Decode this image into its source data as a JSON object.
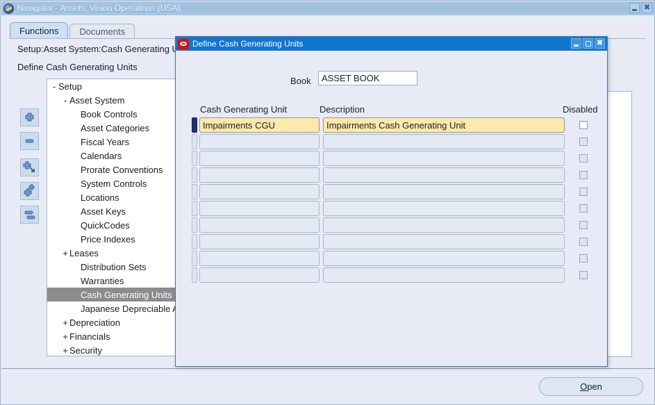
{
  "main_window": {
    "title": "Navigator - Assets, Vision Operations (USA)",
    "logo_icon": "oracle-logo-icon",
    "controls": [
      {
        "name": "minimize",
        "glyph": "minimize-icon"
      },
      {
        "name": "close",
        "glyph": "close-icon"
      }
    ]
  },
  "tabs": [
    {
      "label": "Functions",
      "active": true
    },
    {
      "label": "Documents",
      "active": false
    }
  ],
  "breadcrumb": "Setup:Asset System:Cash Generating Units",
  "heading": "Define Cash Generating Units",
  "tree": [
    {
      "label": "Setup",
      "indent": 0,
      "toggle": "-",
      "selected": false
    },
    {
      "label": "Asset System",
      "indent": 1,
      "toggle": "-",
      "selected": false
    },
    {
      "label": "Book Controls",
      "indent": 2,
      "toggle": "",
      "selected": false
    },
    {
      "label": "Asset Categories",
      "indent": 2,
      "toggle": "",
      "selected": false
    },
    {
      "label": "Fiscal Years",
      "indent": 2,
      "toggle": "",
      "selected": false
    },
    {
      "label": "Calendars",
      "indent": 2,
      "toggle": "",
      "selected": false
    },
    {
      "label": "Prorate Conventions",
      "indent": 2,
      "toggle": "",
      "selected": false
    },
    {
      "label": "System Controls",
      "indent": 2,
      "toggle": "",
      "selected": false
    },
    {
      "label": "Locations",
      "indent": 2,
      "toggle": "",
      "selected": false
    },
    {
      "label": "Asset Keys",
      "indent": 2,
      "toggle": "",
      "selected": false
    },
    {
      "label": "QuickCodes",
      "indent": 2,
      "toggle": "",
      "selected": false
    },
    {
      "label": "Price Indexes",
      "indent": 2,
      "toggle": "",
      "selected": false
    },
    {
      "label": "Leases",
      "indent": 1,
      "toggle": "+",
      "selected": false
    },
    {
      "label": "Distribution Sets",
      "indent": 2,
      "toggle": "",
      "selected": false
    },
    {
      "label": "Warranties",
      "indent": 2,
      "toggle": "",
      "selected": false
    },
    {
      "label": "Cash Generating Units",
      "indent": 2,
      "toggle": "",
      "selected": true
    },
    {
      "label": "Japanese Depreciable Assets",
      "indent": 2,
      "toggle": "",
      "selected": false
    },
    {
      "label": "Depreciation",
      "indent": 1,
      "toggle": "+",
      "selected": false
    },
    {
      "label": "Financials",
      "indent": 1,
      "toggle": "+",
      "selected": false
    },
    {
      "label": "Security",
      "indent": 1,
      "toggle": "+",
      "selected": false
    }
  ],
  "tree_tools": [
    {
      "name": "expand-node-button",
      "icon": "plus-icon"
    },
    {
      "name": "collapse-node-button",
      "icon": "minus-icon"
    },
    {
      "name": "expand-branch-button",
      "icon": "plus-arrow-icon"
    },
    {
      "name": "expand-all-button",
      "icon": "plus-plus-icon"
    },
    {
      "name": "collapse-all-button",
      "icon": "double-minus-icon"
    }
  ],
  "open_button": {
    "label_prefix": "",
    "mnemonic": "O",
    "label_rest": "pen"
  },
  "dialog": {
    "title": "Define Cash Generating Units",
    "logo_icon": "oracle-red-logo-icon",
    "controls": [
      {
        "name": "minimize",
        "glyph": "minimize-icon"
      },
      {
        "name": "maximize",
        "glyph": "maximize-icon"
      },
      {
        "name": "close",
        "glyph": "close-icon"
      }
    ],
    "book": {
      "label": "Book",
      "value": "ASSET BOOK"
    },
    "columns": {
      "unit": "Cash Generating Unit",
      "description": "Description",
      "disabled": "Disabled"
    },
    "rows": [
      {
        "unit": "Impairments CGU",
        "description": "Impairments Cash Generating Unit",
        "disabled": false,
        "current": true
      },
      {
        "unit": "",
        "description": "",
        "disabled": false,
        "current": false
      },
      {
        "unit": "",
        "description": "",
        "disabled": false,
        "current": false
      },
      {
        "unit": "",
        "description": "",
        "disabled": false,
        "current": false
      },
      {
        "unit": "",
        "description": "",
        "disabled": false,
        "current": false
      },
      {
        "unit": "",
        "description": "",
        "disabled": false,
        "current": false
      },
      {
        "unit": "",
        "description": "",
        "disabled": false,
        "current": false
      },
      {
        "unit": "",
        "description": "",
        "disabled": false,
        "current": false
      },
      {
        "unit": "",
        "description": "",
        "disabled": false,
        "current": false
      },
      {
        "unit": "",
        "description": "",
        "disabled": false,
        "current": false
      }
    ]
  },
  "colors": {
    "dialog_title_bg": "#1176cf",
    "main_title_bg": "#a2c2e2",
    "body_bg": "#e8ebf5",
    "current_row": "#fde9a9",
    "selection": "#8c8c8c",
    "oracle_red": "#d90e0e"
  }
}
